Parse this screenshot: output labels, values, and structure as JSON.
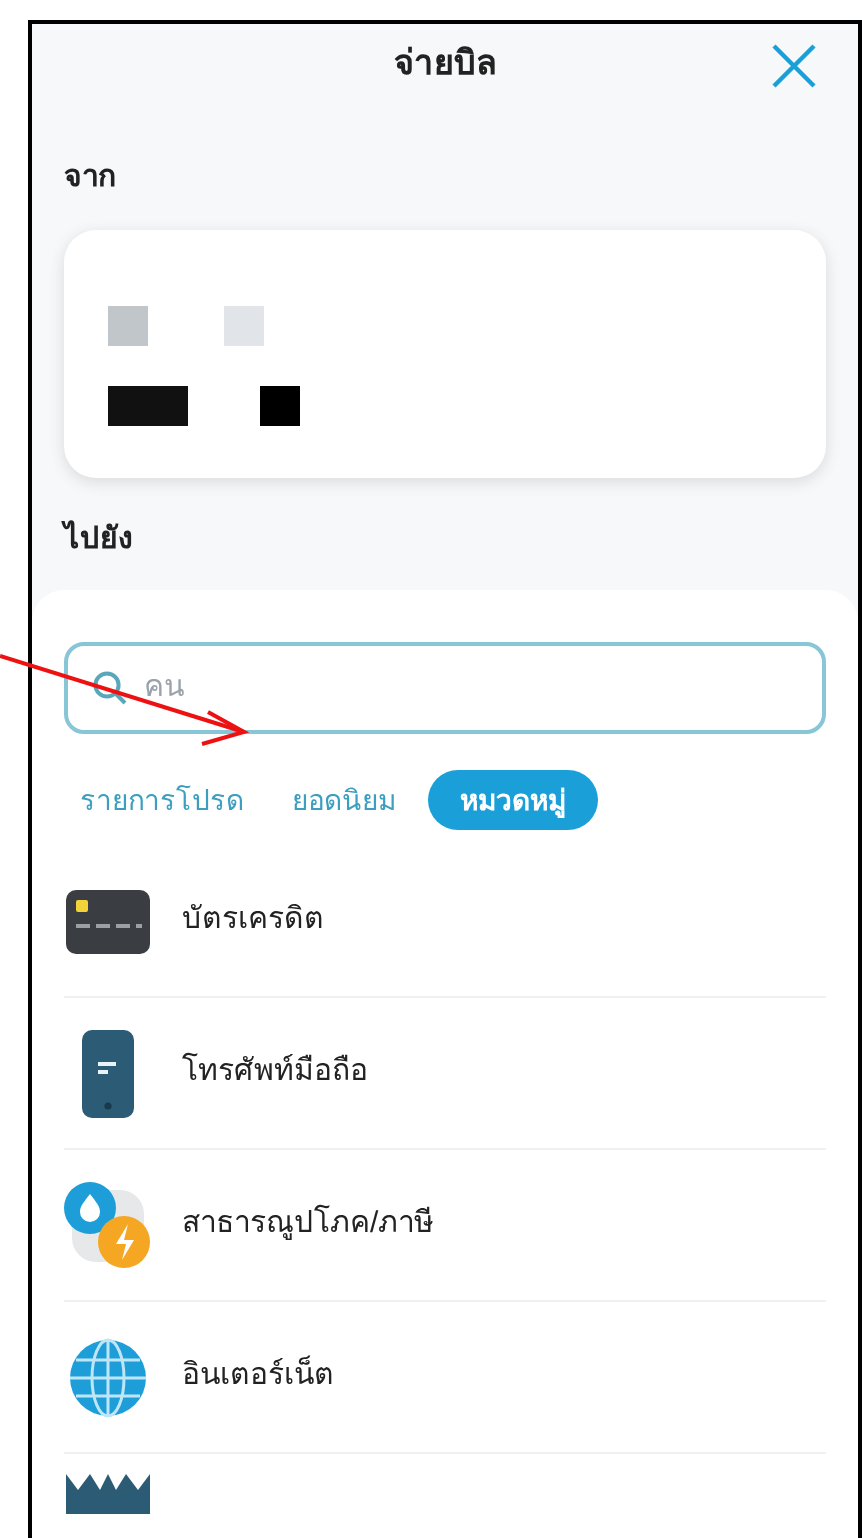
{
  "header": {
    "title": "จ่ายบิล"
  },
  "from": {
    "label": "จาก"
  },
  "to": {
    "label": "ไปยัง"
  },
  "search": {
    "placeholder": "คน"
  },
  "tabs": [
    {
      "label": "รายการโปรด",
      "selected": false
    },
    {
      "label": "ยอดนิยม",
      "selected": false
    },
    {
      "label": "หมวดหมู่",
      "selected": true
    }
  ],
  "categories": [
    {
      "kind": "card",
      "label": "บัตรเครดิต"
    },
    {
      "kind": "phone",
      "label": "โทรศัพท์มือถือ"
    },
    {
      "kind": "utility",
      "label": "สาธารณูปโภค/ภาษี"
    },
    {
      "kind": "internet",
      "label": "อินเตอร์เน็ต"
    },
    {
      "kind": "crown"
    }
  ]
}
